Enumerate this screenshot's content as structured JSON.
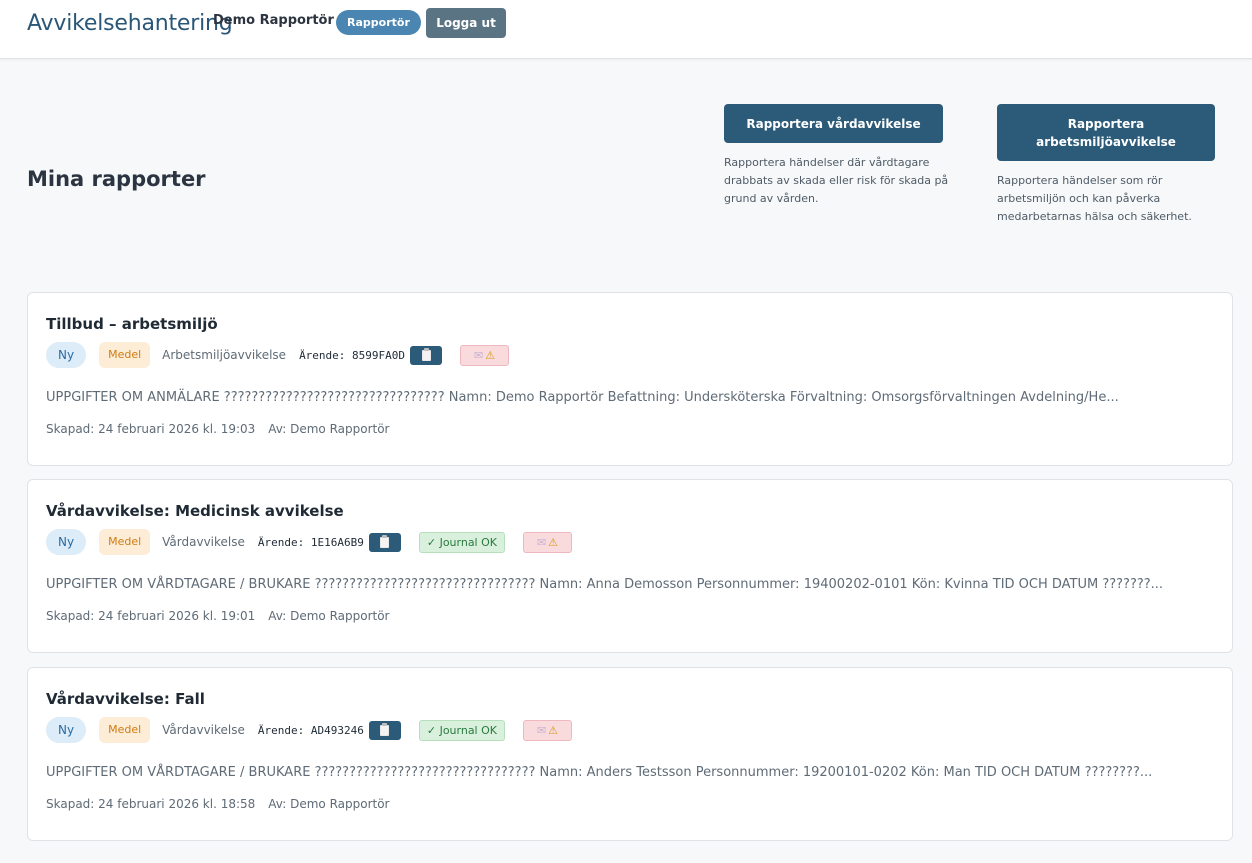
{
  "header": {
    "app_title": "Avvikelsehantering",
    "user_name": "Demo Rapportör",
    "role_badge": "Rapportör",
    "logout_label": "Logga ut"
  },
  "page": {
    "title": "Mina rapporter"
  },
  "actions": [
    {
      "label": "Rapportera vårdavvikelse",
      "description": "Rapportera händelser där vårdtagare drabbats av skada eller risk för skada på grund av vården."
    },
    {
      "label": "Rapportera arbetsmiljöavvikelse",
      "description": "Rapportera händelser som rör arbetsmiljön och kan påverka medarbetarnas hälsa och säkerhet."
    }
  ],
  "reports": [
    {
      "title": "Tillbud – arbetsmiljö",
      "status": "Ny",
      "severity": "Medel",
      "type": "Arbetsmiljöavvikelse",
      "arende": "Ärende: 8599FA0D",
      "journal": "",
      "preview": "UPPGIFTER OM ANMÄLARE ???????????????????????????????? Namn: Demo Rapportör Befattning: Undersköterska Förvaltning: Omsorgsförvaltningen Avdelning/He...",
      "created": "Skapad: 24 februari 2026 kl. 19:03",
      "author": "Av: Demo Rapportör"
    },
    {
      "title": "Vårdavvikelse: Medicinsk avvikelse",
      "status": "Ny",
      "severity": "Medel",
      "type": "Vårdavvikelse",
      "arende": "Ärende: 1E16A6B9",
      "journal": "✓ Journal OK",
      "preview": "UPPGIFTER OM VÅRDTAGARE / BRUKARE ???????????????????????????????? Namn: Anna Demosson Personnummer: 19400202-0101 Kön: Kvinna TID OCH DATUM ???????...",
      "created": "Skapad: 24 februari 2026 kl. 19:01",
      "author": "Av: Demo Rapportör"
    },
    {
      "title": "Vårdavvikelse: Fall",
      "status": "Ny",
      "severity": "Medel",
      "type": "Vårdavvikelse",
      "arende": "Ärende: AD493246",
      "journal": "✓ Journal OK",
      "preview": "UPPGIFTER OM VÅRDTAGARE / BRUKARE ???????????????????????????????? Namn: Anders Testsson Personnummer: 19200101-0202 Kön: Man TID OCH DATUM ????????...",
      "created": "Skapad: 24 februari 2026 kl. 18:58",
      "author": "Av: Demo Rapportör"
    }
  ],
  "icons": {
    "copy": "clipboard-icon",
    "notify": "envelope-icon",
    "warning": "warning-icon"
  },
  "colors": {
    "primary": "#2c5b7a",
    "title": "#2a5778",
    "role_badge": "#4a86b1",
    "logout": "#5b7484",
    "badge_ny_bg": "#dcecf8",
    "badge_medel_bg": "#fdecd6",
    "journal_bg": "#d8f0dc",
    "flag_bg": "#f9dadd"
  }
}
